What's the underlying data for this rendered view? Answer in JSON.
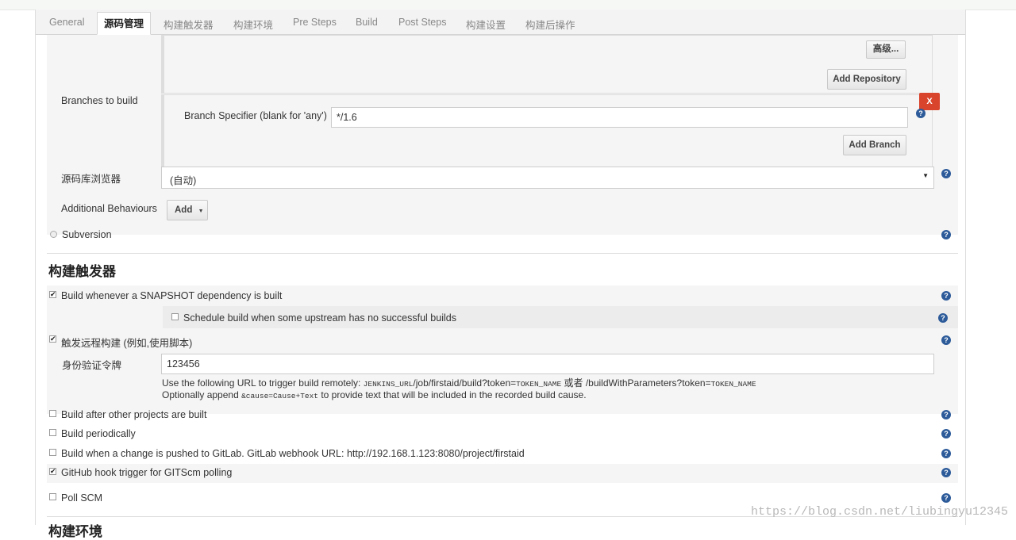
{
  "tabs": [
    {
      "label": "General"
    },
    {
      "label": "源码管理"
    },
    {
      "label": "构建触发器"
    },
    {
      "label": "构建环境"
    },
    {
      "label": "Pre Steps"
    },
    {
      "label": "Build"
    },
    {
      "label": "Post Steps"
    },
    {
      "label": "构建设置"
    },
    {
      "label": "构建后操作"
    }
  ],
  "scm": {
    "advanced_button": "高级...",
    "add_repository_button": "Add Repository",
    "branches_label": "Branches to build",
    "branch_specifier_label": "Branch Specifier (blank for 'any')",
    "branch_specifier_value": "*/1.6",
    "delete_branch_button": "X",
    "add_branch_button": "Add Branch",
    "browser_label": "源码库浏览器",
    "browser_value": "(自动)",
    "additional_behaviours_label": "Additional Behaviours",
    "add_button": "Add",
    "subversion_label": "Subversion"
  },
  "triggers": {
    "section_title": "构建触发器",
    "snapshot_label": "Build whenever a SNAPSHOT dependency is built",
    "snapshot_checked": true,
    "schedule_upstream_label": "Schedule build when some upstream has no successful builds",
    "schedule_upstream_checked": false,
    "remote_label": "触发远程构建 (例如,使用脚本)",
    "remote_checked": true,
    "token_label": "身份验证令牌",
    "token_value": "123456",
    "url_hint": {
      "prefix": "Use the following URL to trigger build remotely: ",
      "url1_code": "JENKINS_URL",
      "url1_mid": "/job/firstaid/build?token=",
      "url1_token": "TOKEN_NAME",
      "or_text": " 或者 /buildWithParameters?token=",
      "url2_token": "TOKEN_NAME"
    },
    "append_hint": {
      "prefix": "Optionally append ",
      "code": "&cause=Cause+Text",
      "suffix": " to provide text that will be included in the recorded build cause."
    },
    "after_other_label": "Build after other projects are built",
    "after_other_checked": false,
    "periodically_label": "Build periodically",
    "periodically_checked": false,
    "gitlab_label": "Build when a change is pushed to GitLab. GitLab webhook URL: http://192.168.1.123:8080/project/firstaid",
    "gitlab_checked": false,
    "github_label": "GitHub hook trigger for GITScm polling",
    "github_checked": true,
    "poll_scm_label": "Poll SCM",
    "poll_scm_checked": false
  },
  "next_section_partial": "构建环境",
  "watermark": "https://blog.csdn.net/liubingyu12345",
  "colors": {
    "delete": "#d9442c",
    "help": "#2d5b9a",
    "panel_bg": "#f5f5f5"
  }
}
